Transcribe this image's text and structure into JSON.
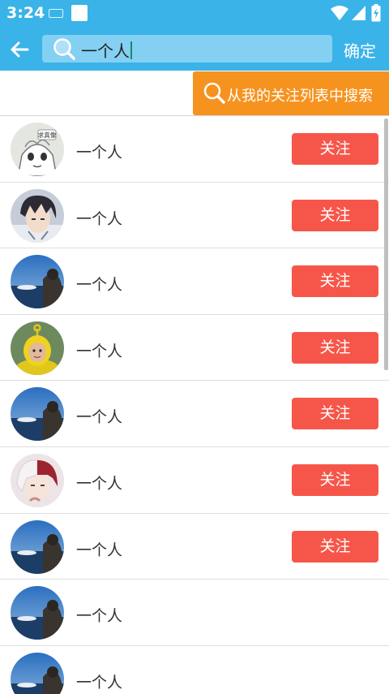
{
  "status_bar": {
    "time": "3:24"
  },
  "app_bar": {
    "search_query": "一个人",
    "confirm_label": "确定"
  },
  "search_in_following_label": "从我的关注列表中搜索",
  "avatar_badge_text": "求真像",
  "users": [
    {
      "name": "一个人",
      "follow_label": "关注",
      "avatar": "cartoon-face"
    },
    {
      "name": "一个人",
      "follow_label": "关注",
      "avatar": "anime-boy"
    },
    {
      "name": "一个人",
      "follow_label": "关注",
      "avatar": "seascape-person"
    },
    {
      "name": "一个人",
      "follow_label": "关注",
      "avatar": "teletubby"
    },
    {
      "name": "一个人",
      "follow_label": "关注",
      "avatar": "seascape-person"
    },
    {
      "name": "一个人",
      "follow_label": "关注",
      "avatar": "anime-red-white-hair"
    },
    {
      "name": "一个人",
      "follow_label": "关注",
      "avatar": "seascape-person"
    },
    {
      "name": "一个人",
      "follow_label": "",
      "avatar": "seascape-person"
    },
    {
      "name": "一个人",
      "follow_label": "",
      "avatar": "seascape-person"
    }
  ],
  "colors": {
    "app_bar": "#3ab3e9",
    "search_box": "#84d0f3",
    "orange_button": "#f6931f",
    "follow_button": "#f6564a"
  }
}
